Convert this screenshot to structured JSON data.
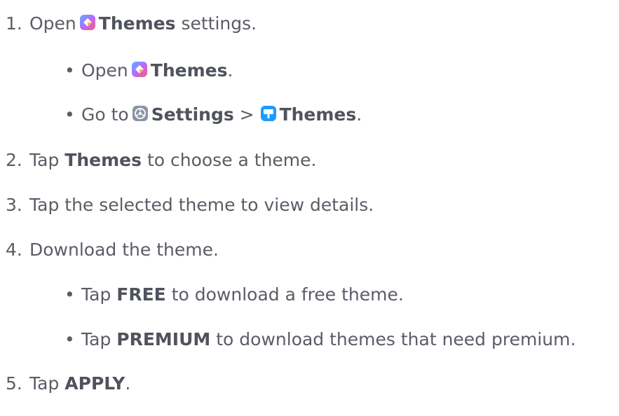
{
  "colors": {
    "text": "#5a5d66",
    "bold": "#50535c",
    "themes_app_icon": [
      "#ff5a6e",
      "#ffb84d",
      "#5ab0ff",
      "#b46cff"
    ],
    "settings_icon": "#8a93a6",
    "themes_settings_icon": "#1e9bff"
  },
  "steps": [
    {
      "number": "1.",
      "before": "Open",
      "bold": "Themes",
      "after": "settings.",
      "icon": "themes-app-icon"
    },
    {
      "bullet": "•",
      "before": "Open",
      "bold": "Themes",
      "after": ".",
      "icon": "themes-app-icon"
    },
    {
      "bullet": "•",
      "before": "Go to",
      "bold": "Settings",
      "sep": " > ",
      "bold2": "Themes",
      "after": ".",
      "icon": "settings-icon",
      "icon2": "themes-settings-icon"
    },
    {
      "number": "2.",
      "before": "Tap",
      "bold": "Themes",
      "after": "to choose a theme."
    },
    {
      "number": "3.",
      "text": "Tap the selected theme to view details."
    },
    {
      "number": "4.",
      "text": "Download the theme."
    },
    {
      "bullet": "•",
      "before": "Tap",
      "bold": "FREE",
      "after": "to download a free theme."
    },
    {
      "bullet": "•",
      "before": "Tap",
      "bold": "PREMIUM",
      "after": "to download themes that need premium."
    },
    {
      "number": "5.",
      "before": "Tap",
      "bold": "APPLY",
      "after": "."
    }
  ]
}
